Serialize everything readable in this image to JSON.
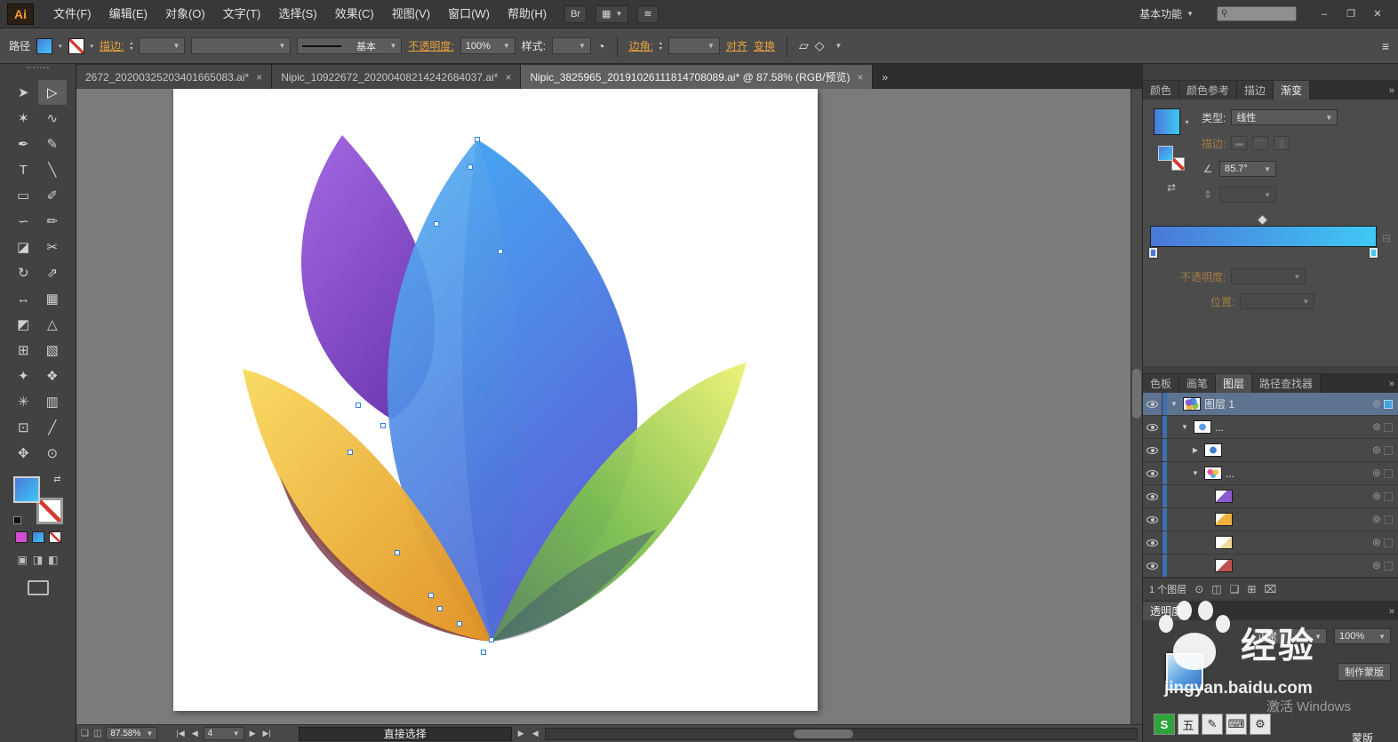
{
  "colors": {
    "accent": "#e8a33d",
    "grad-start": "#4a78d8",
    "grad-end": "#3fc8f5",
    "selection-blue": "#2f7de0",
    "petal-purple": "#8a55cc",
    "petal-blue": "#4a90e6",
    "petal-yellow": "#eeb33c",
    "petal-green": "#8bc34a"
  },
  "icons": {
    "dropdown": "▼",
    "stepper_up": "▴",
    "stepper_down": "▾",
    "swap": "⇄",
    "bridge": "Br",
    "arrange": "▦",
    "share": "≋",
    "search": "⚲",
    "panel_menu": "≡",
    "recolor": "◔",
    "collapse": "»",
    "tab_close": "×",
    "angle": "∠",
    "aspect": "⇕",
    "reverse": "⇄",
    "trash": "⊟",
    "target": "◎",
    "locate": "⊙",
    "clip_mask": "◫",
    "new_sublayer": "❏",
    "new_layer": "⊞",
    "delete": "⌧",
    "prev": "◀",
    "next": "▶",
    "free_a": "▱",
    "free_b": "◇",
    "stroke_btn1": "▬",
    "stroke_btn2": "⌒",
    "stroke_btn3": "∥",
    "mode1": "▣",
    "mode2": "◨",
    "mode3": "◧",
    "status_a": "❏",
    "status_b": "◫",
    "gradient_tab": "◇"
  },
  "menubar": {
    "logo": "Ai",
    "items": [
      "文件(F)",
      "编辑(E)",
      "对象(O)",
      "文字(T)",
      "选择(S)",
      "效果(C)",
      "视图(V)",
      "窗口(W)",
      "帮助(H)"
    ],
    "workspace": "基本功能",
    "window_buttons": [
      "–",
      "❐",
      "✕"
    ]
  },
  "controlbar": {
    "selection_label": "路径",
    "stroke_label": "描边:",
    "brush_value": "基本",
    "opacity_label": "不透明度:",
    "opacity_value": "100%",
    "style_label": "样式:",
    "corner_label": "边角:",
    "align_label": "对齐",
    "transform_label": "变换"
  },
  "tabs": {
    "items": [
      {
        "title": "2672_20200325203401665083.ai*",
        "state": ""
      },
      {
        "title": "Nipic_10922672_20200408214242684037.ai*",
        "state": ""
      },
      {
        "title": "Nipic_3825965_20191026111814708089.ai* @ 87.58% (RGB/预览)",
        "state": "active"
      }
    ],
    "overflow": "»"
  },
  "tools": [
    {
      "name": "selection-tool",
      "glyph": "➤",
      "cls": "rot"
    },
    {
      "name": "direct-selection-tool",
      "glyph": "▷",
      "cls": "rot active"
    },
    {
      "name": "magic-wand-tool",
      "glyph": "✶"
    },
    {
      "name": "lasso-tool",
      "glyph": "∿"
    },
    {
      "name": "pen-tool",
      "glyph": "✒"
    },
    {
      "name": "curvature-tool",
      "glyph": "✎"
    },
    {
      "name": "type-tool",
      "glyph": "T"
    },
    {
      "name": "line-segment-tool",
      "glyph": "╲"
    },
    {
      "name": "rectangle-tool",
      "glyph": "▭"
    },
    {
      "name": "paintbrush-tool",
      "glyph": "✐"
    },
    {
      "name": "shaper-tool",
      "glyph": "∽"
    },
    {
      "name": "pencil-tool",
      "glyph": "✏"
    },
    {
      "name": "eraser-tool",
      "glyph": "◪"
    },
    {
      "name": "scissors-tool",
      "glyph": "✂"
    },
    {
      "name": "rotate-tool",
      "glyph": "↻"
    },
    {
      "name": "scale-tool",
      "glyph": "⇗"
    },
    {
      "name": "width-tool",
      "glyph": "↔"
    },
    {
      "name": "free-transform-tool",
      "glyph": "▦"
    },
    {
      "name": "shape-builder-tool",
      "glyph": "◩"
    },
    {
      "name": "perspective-grid-tool",
      "glyph": "△"
    },
    {
      "name": "mesh-tool",
      "glyph": "⊞"
    },
    {
      "name": "gradient-tool",
      "glyph": "▧"
    },
    {
      "name": "eyedropper-tool",
      "glyph": "✦"
    },
    {
      "name": "blend-tool",
      "glyph": "❖"
    },
    {
      "name": "symbol-sprayer-tool",
      "glyph": "✳"
    },
    {
      "name": "column-graph-tool",
      "glyph": "▥"
    },
    {
      "name": "artboard-tool",
      "glyph": "⊡"
    },
    {
      "name": "slice-tool",
      "glyph": "╱"
    },
    {
      "name": "hand-tool",
      "glyph": "✥"
    },
    {
      "name": "zoom-tool",
      "glyph": "⊙"
    }
  ],
  "gradient_panel": {
    "tabs": [
      {
        "label": "颜色",
        "state": ""
      },
      {
        "label": "颜色参考",
        "state": ""
      },
      {
        "label": "描边",
        "state": ""
      },
      {
        "label": "渐变",
        "state": "active"
      }
    ],
    "type_label": "类型:",
    "type_value": "线性",
    "stroke_label": "描边:",
    "angle_value": "85.7°",
    "opacity_label": "不透明度:",
    "location_label": "位置:"
  },
  "layers_panel": {
    "tabs": [
      {
        "label": "色板",
        "state": ""
      },
      {
        "label": "画笔",
        "state": ""
      },
      {
        "label": "图层",
        "state": "active"
      },
      {
        "label": "路径查找器",
        "state": ""
      }
    ],
    "rows": [
      {
        "label": "图层 1",
        "expander": "▼",
        "thumb": "th-flower",
        "indent": "ind0",
        "state": "selected"
      },
      {
        "label": "...",
        "expander": "▼",
        "thumb": "th-blue",
        "indent": "ind1",
        "state": ""
      },
      {
        "label": "",
        "expander": "▶",
        "thumb": "th-blue2",
        "indent": "ind2",
        "state": ""
      },
      {
        "label": "...",
        "expander": "▼",
        "thumb": "th-multi",
        "indent": "ind2",
        "state": ""
      },
      {
        "label": "",
        "expander": "",
        "thumb": "th-purple",
        "indent": "ind3",
        "state": ""
      },
      {
        "label": "",
        "expander": "",
        "thumb": "th-gold",
        "indent": "ind3",
        "state": ""
      },
      {
        "label": "",
        "expander": "",
        "thumb": "th-pale",
        "indent": "ind3",
        "state": ""
      },
      {
        "label": "",
        "expander": "",
        "thumb": "th-red",
        "indent": "ind3",
        "state": ""
      }
    ],
    "footer_count": "1 个图层"
  },
  "transparency_panel": {
    "title": "透明度",
    "blend_value": "正常",
    "opacity_value": "100%",
    "make_mask": "制作蒙版",
    "mask_label": "蒙版"
  },
  "statusbar": {
    "zoom": "87.58%",
    "nav_first": "|◀",
    "nav_prev": "◀",
    "artboard": "4",
    "nav_next": "▶",
    "nav_last": "▶|",
    "status": "直接选择"
  },
  "watermark": {
    "brand": "经验",
    "site": "jingyan.baidu.com"
  },
  "activate": {
    "line": "激活 Windows"
  },
  "ime": {
    "items": [
      {
        "glyph": "S",
        "cls": "green"
      },
      {
        "glyph": "五"
      },
      {
        "glyph": "✎"
      },
      {
        "glyph": "⌨"
      },
      {
        "glyph": "⚙"
      }
    ]
  }
}
